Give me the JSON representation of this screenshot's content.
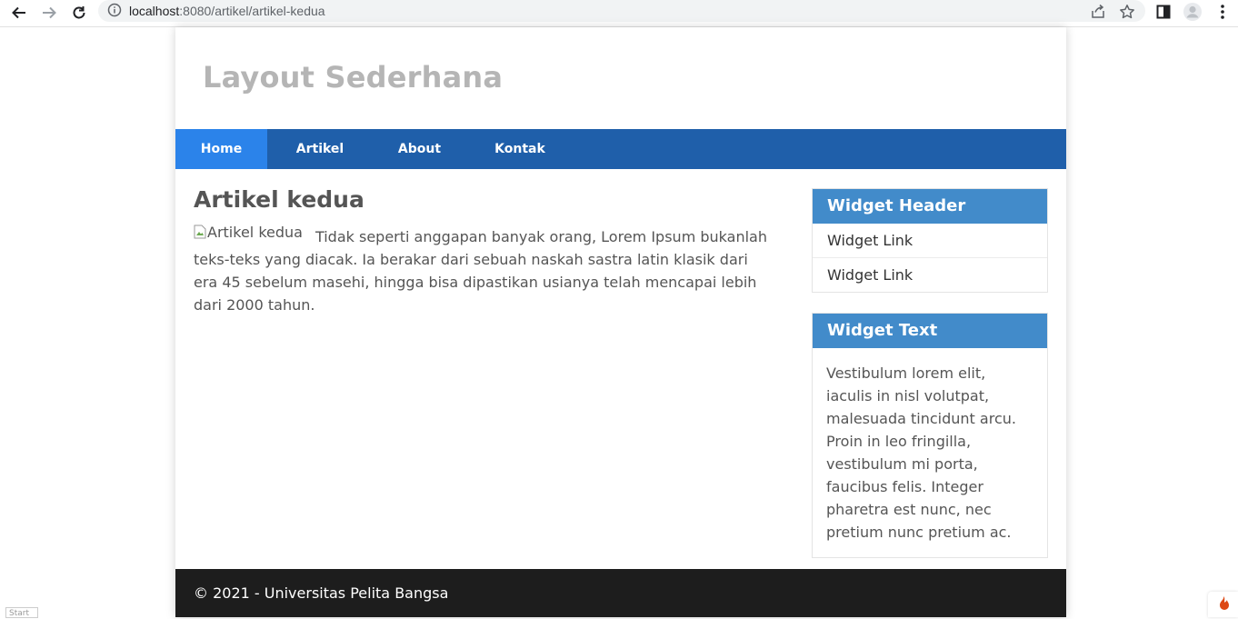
{
  "browser": {
    "url_host": "localhost",
    "url_path": ":8080/artikel/artikel-kedua"
  },
  "site": {
    "title": "Layout Sederhana",
    "nav": [
      {
        "label": "Home",
        "active": true
      },
      {
        "label": "Artikel",
        "active": false
      },
      {
        "label": "About",
        "active": false
      },
      {
        "label": "Kontak",
        "active": false
      }
    ]
  },
  "article": {
    "title": "Artikel kedua",
    "image_alt": "Artikel kedua",
    "body": "Tidak seperti anggapan banyak orang, Lorem Ipsum bukanlah teks-teks yang diacak. Ia berakar dari sebuah naskah sastra latin klasik dari era 45 sebelum masehi, hingga bisa dipastikan usianya telah mencapai lebih dari 2000 tahun."
  },
  "sidebar": {
    "widget_links": {
      "header": "Widget Header",
      "links": [
        "Widget Link",
        "Widget Link"
      ]
    },
    "widget_text": {
      "header": "Widget Text",
      "text": "Vestibulum lorem elit, iaculis in nisl volutpat, malesuada tincidunt arcu. Proin in leo fringilla, vestibulum mi porta, faucibus felis. Integer pharetra est nunc, nec pretium nunc pretium ac."
    }
  },
  "footer": {
    "text": "© 2021 - Universitas Pelita Bangsa"
  },
  "debug": {
    "start_label": "Start"
  },
  "colors": {
    "navbar": "#1f5faa",
    "nav_active": "#2b83ea",
    "widget_header": "#428bca",
    "footer": "#1d1d1d",
    "site_title": "#b5b5b5"
  }
}
